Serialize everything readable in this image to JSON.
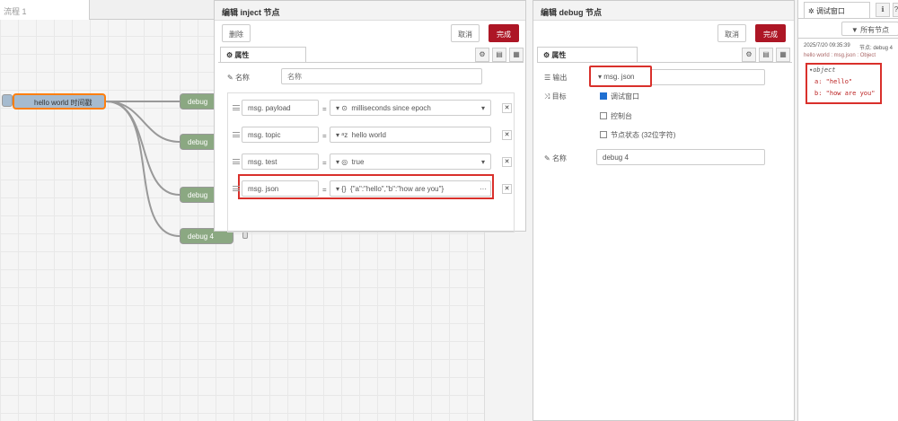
{
  "workspace": {
    "flow_tab": "流程 1",
    "inject_node_label": "hello world 时间戳",
    "debug_nodes": [
      "debug",
      "debug",
      "debug",
      "debug 4"
    ]
  },
  "inject_dialog": {
    "title": "编辑 inject 节点",
    "delete": "删除",
    "cancel": "取消",
    "done": "完成",
    "props_tab": "属性",
    "name_label": "名称",
    "name_placeholder": "名称",
    "rows": [
      {
        "prop": "payload",
        "value": "milliseconds since epoch",
        "type_icon": "clock"
      },
      {
        "prop": "topic",
        "value": "hello world",
        "type_icon": "az"
      },
      {
        "prop": "test",
        "value": "true",
        "type_icon": "bool"
      },
      {
        "prop": "json",
        "value": "{\"a\":\"hello\",\"b\":\"how are you\"}",
        "type_icon": "{}"
      }
    ],
    "msg_prefix": "msg.",
    "eq": "="
  },
  "debug_dialog": {
    "title": "编辑 debug 节点",
    "cancel": "取消",
    "done": "完成",
    "props_tab": "属性",
    "output_label": "输出",
    "output_value": "msg. json",
    "target_label": "目标",
    "opt_debug_window": "调试窗口",
    "opt_console": "控制台",
    "opt_node_status": "节点状态 (32位字符)",
    "name_label": "名称",
    "name_value": "debug 4"
  },
  "sidebar": {
    "tab_label": "调试窗口",
    "filter_label": "所有节点",
    "timestamp": "2025/7/20 09:35:39",
    "node_ref": "节点: debug 4",
    "msg_path": "hello world : msg.json : Object",
    "obj_type": "object",
    "a_line": "a: \"hello\"",
    "b_line": "b: \"how are you\""
  }
}
